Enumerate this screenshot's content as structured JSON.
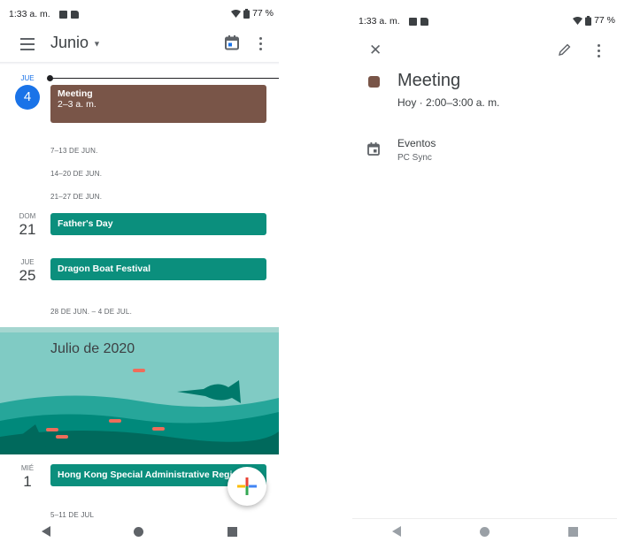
{
  "left": {
    "status": {
      "time": "1:33 a. m.",
      "battery": "77 %"
    },
    "toolbar": {
      "month": "Junio",
      "dropdown_icon": "caret-down",
      "menu_icon": "menu",
      "today_icon": "calendar-today",
      "more_icon": "more-vert"
    },
    "today": {
      "weekday": "JUE",
      "day": "4"
    },
    "meeting_event": {
      "title": "Meeting",
      "time": "2–3 a. m.",
      "color": "#795548"
    },
    "weeks": [
      "7–13 DE JUN.",
      "14–20 DE JUN.",
      "21–27 DE JUN.",
      "28 DE JUN. – 4 DE JUL.",
      "5–11 DE JUL"
    ],
    "days": [
      {
        "weekday": "DOM",
        "day": "21",
        "event": "Father's Day",
        "color": "#0b8f7d"
      },
      {
        "weekday": "JUE",
        "day": "25",
        "event": "Dragon Boat Festival",
        "color": "#0b8f7d"
      },
      {
        "weekday": "MIÉ",
        "day": "1",
        "event": "Hong Kong Special Administrative Regi",
        "color": "#0b8f7d"
      }
    ],
    "banner": {
      "title": "Julio de 2020"
    },
    "fab_icon": "add"
  },
  "right": {
    "status": {
      "time": "1:33 a. m.",
      "battery": "77 %"
    },
    "toolbar": {
      "close_icon": "close",
      "edit_icon": "pencil",
      "more_icon": "more-vert"
    },
    "event": {
      "title": "Meeting",
      "when": "Hoy · 2:00–3:00 a. m.",
      "color": "#795548"
    },
    "calendar": {
      "name": "Eventos",
      "account": "PC Sync",
      "icon": "calendar"
    }
  },
  "nav": {
    "back_icon": "back-triangle",
    "home_icon": "home-circle",
    "recents_icon": "recents-square"
  }
}
